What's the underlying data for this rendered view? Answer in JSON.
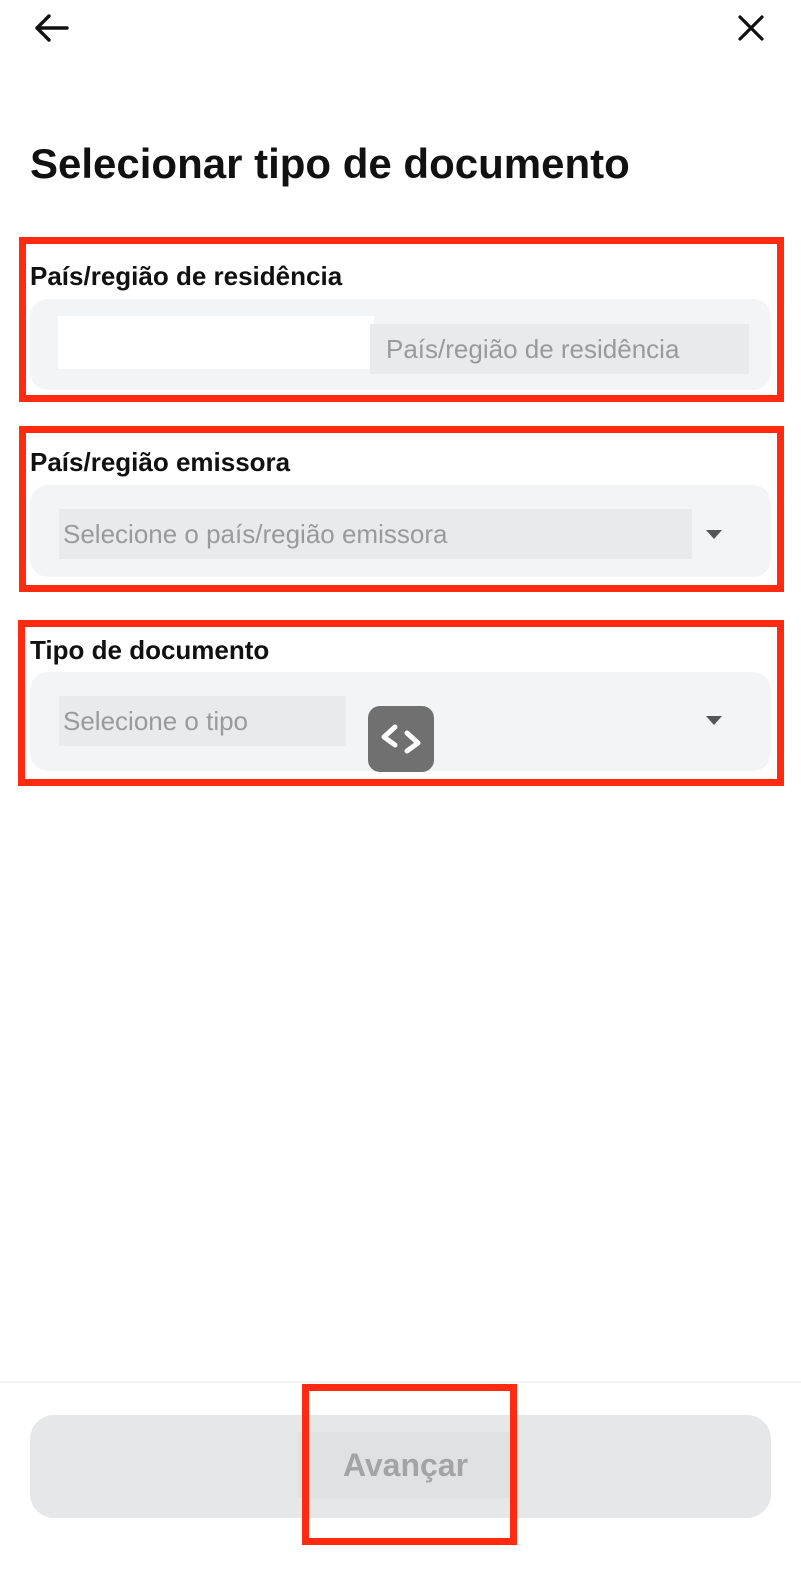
{
  "header": {
    "back_icon": "arrow-left-icon",
    "close_icon": "close-icon"
  },
  "page": {
    "title": "Selecionar tipo de documento"
  },
  "fields": {
    "residence": {
      "label": "País/região de residência",
      "placeholder": "País/região de residência"
    },
    "issuing": {
      "label": "País/região emissora",
      "placeholder": "Selecione o país/região emissora",
      "dropdown_icon": "caret-down-icon"
    },
    "doc_type": {
      "label": "Tipo de documento",
      "placeholder": "Selecione o tipo",
      "dropdown_icon": "caret-down-icon"
    }
  },
  "overlay": {
    "icon": "code-brackets-icon"
  },
  "footer": {
    "next_label": "Avançar"
  },
  "colors": {
    "highlight": "#ff2a10",
    "field_bg": "#f3f4f6",
    "placeholder_text": "#9a9a9a",
    "disabled_button_bg": "#e6e7e9",
    "disabled_button_text": "#a4a4a4"
  }
}
